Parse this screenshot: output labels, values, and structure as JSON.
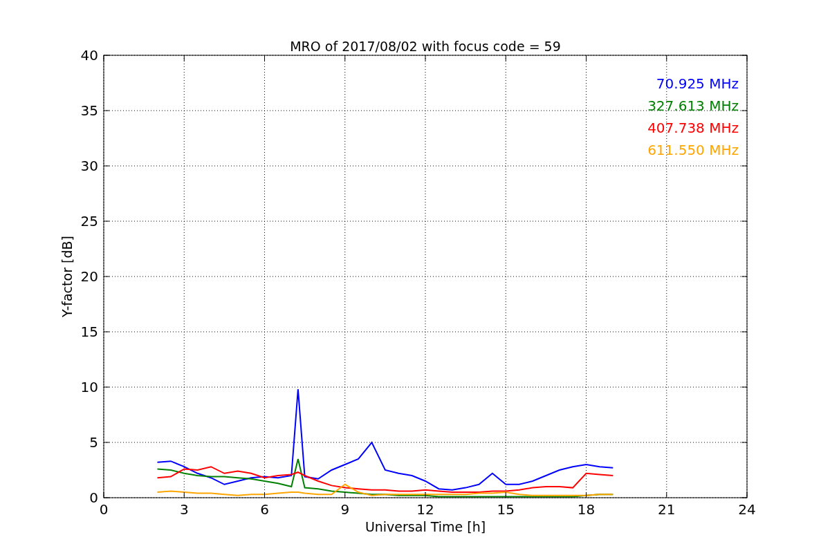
{
  "chart_data": {
    "type": "line",
    "title": "MRO of 2017/08/02 with focus code = 59",
    "xlabel": "Universal Time [h]",
    "ylabel": "Y-factor [dB]",
    "x": [
      2,
      2.5,
      3,
      3.5,
      4,
      4.5,
      5,
      5.5,
      6,
      6.5,
      7,
      7.25,
      7.5,
      8,
      8.5,
      9,
      9.5,
      10,
      10.5,
      11,
      11.5,
      12,
      12.5,
      13,
      13.5,
      14,
      14.5,
      15,
      15.5,
      16,
      16.5,
      17,
      17.5,
      18,
      18.5,
      19
    ],
    "series": [
      {
        "name": "70.925 MHz",
        "color": "#0000ff",
        "values": [
          3.2,
          3.3,
          2.8,
          2.2,
          1.8,
          1.2,
          1.5,
          1.8,
          1.9,
          1.8,
          2.0,
          9.8,
          1.9,
          1.7,
          2.5,
          3.0,
          3.5,
          5.0,
          2.5,
          2.2,
          2.0,
          1.5,
          0.8,
          0.7,
          0.9,
          1.2,
          2.2,
          1.2,
          1.2,
          1.5,
          2.0,
          2.5,
          2.8,
          3.0,
          2.8,
          2.7
        ]
      },
      {
        "name": "327.613 MHz",
        "color": "#008000",
        "values": [
          2.6,
          2.5,
          2.2,
          2.0,
          1.9,
          1.9,
          1.8,
          1.7,
          1.5,
          1.3,
          1.0,
          3.5,
          0.9,
          0.8,
          0.6,
          0.5,
          0.4,
          0.3,
          0.3,
          0.2,
          0.2,
          0.2,
          0.1,
          0.1,
          0.1,
          0.1,
          0.1,
          0.1,
          0.1,
          0.1,
          0.1,
          0.1,
          0.1,
          0.2,
          0.3,
          0.3
        ]
      },
      {
        "name": "407.738 MHz",
        "color": "#ff0000",
        "values": [
          1.8,
          1.9,
          2.6,
          2.5,
          2.8,
          2.2,
          2.4,
          2.2,
          1.8,
          2.0,
          2.1,
          2.3,
          2.0,
          1.5,
          1.1,
          0.9,
          0.8,
          0.7,
          0.7,
          0.6,
          0.6,
          0.7,
          0.6,
          0.5,
          0.5,
          0.5,
          0.6,
          0.6,
          0.7,
          0.9,
          1.0,
          1.0,
          0.9,
          2.2,
          2.1,
          2.0
        ]
      },
      {
        "name": "611.550 MHz",
        "color": "#ffa500",
        "values": [
          0.5,
          0.6,
          0.5,
          0.4,
          0.4,
          0.3,
          0.2,
          0.3,
          0.3,
          0.4,
          0.5,
          0.5,
          0.4,
          0.3,
          0.3,
          1.2,
          0.5,
          0.2,
          0.3,
          0.3,
          0.3,
          0.3,
          0.3,
          0.3,
          0.3,
          0.4,
          0.4,
          0.5,
          0.3,
          0.2,
          0.2,
          0.2,
          0.2,
          0.2,
          0.3,
          0.3
        ]
      }
    ],
    "xlim": [
      0,
      24
    ],
    "ylim": [
      0,
      40
    ],
    "xticks": [
      0,
      3,
      6,
      9,
      12,
      15,
      18,
      21,
      24
    ],
    "yticks": [
      0,
      5,
      10,
      15,
      20,
      25,
      30,
      35,
      40
    ],
    "grid": true
  }
}
